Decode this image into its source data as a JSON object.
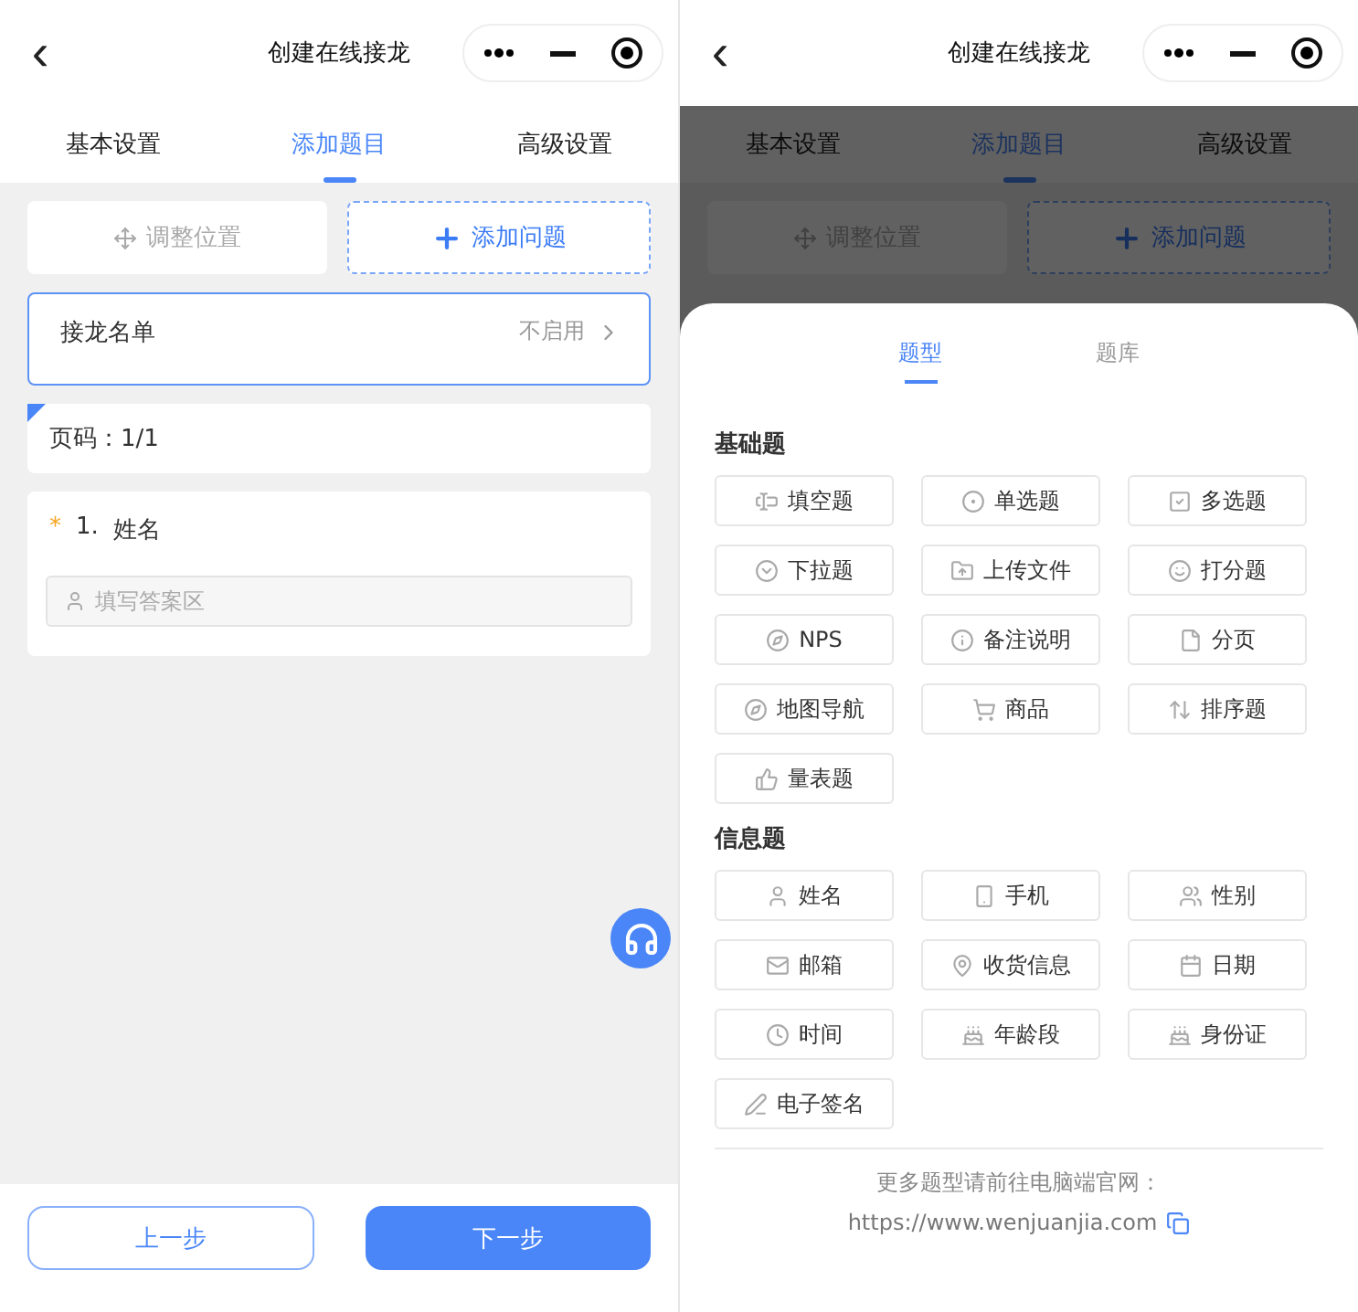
{
  "screens": [
    {
      "nav": {
        "back": "‹",
        "title": "创建在线接龙"
      },
      "tabs": [
        {
          "label": "基本设置",
          "selected": false
        },
        {
          "label": "添加题目",
          "selected": true
        },
        {
          "label": "高级设置",
          "selected": false
        }
      ],
      "actions": [
        {
          "label": "调整位置",
          "disabled": true,
          "kind": "move"
        },
        {
          "label": "添加问题",
          "disabled": false,
          "kind": "add"
        }
      ],
      "list_setting": {
        "label": "接龙名单",
        "value": "不启用"
      },
      "page_marker": "页码：1/1",
      "questions": [
        {
          "required": true,
          "required_mark": "*",
          "number": "1.",
          "title": "姓名",
          "placeholder": "填写答案区"
        }
      ],
      "footer": {
        "prev": "上一步",
        "next": "下一步"
      }
    },
    {
      "nav": {
        "back": "‹",
        "title": "创建在线接龙"
      },
      "tabs": [
        {
          "label": "基本设置",
          "selected": false
        },
        {
          "label": "添加题目",
          "selected": true
        },
        {
          "label": "高级设置",
          "selected": false
        }
      ],
      "actions": [
        {
          "label": "调整位置",
          "disabled": true,
          "kind": "move"
        },
        {
          "label": "添加问题",
          "disabled": false,
          "kind": "add"
        }
      ],
      "sheet": {
        "tabs": [
          {
            "label": "题型",
            "selected": true
          },
          {
            "label": "题库",
            "selected": false
          }
        ],
        "sections": [
          {
            "title": "基础题",
            "items": [
              "填空题",
              "单选题",
              "多选题",
              "下拉题",
              "上传文件",
              "打分题",
              "NPS",
              "备注说明",
              "分页",
              "地图导航",
              "商品",
              "排序题",
              "量表题"
            ]
          },
          {
            "title": "信息题",
            "items": [
              "姓名",
              "手机",
              "性别",
              "邮箱",
              "收货信息",
              "日期",
              "时间",
              "年龄段",
              "身份证",
              "电子签名"
            ]
          }
        ],
        "note": "更多题型请前往电脑端官网：",
        "link": "https://www.wenjuanjia.com"
      }
    }
  ]
}
